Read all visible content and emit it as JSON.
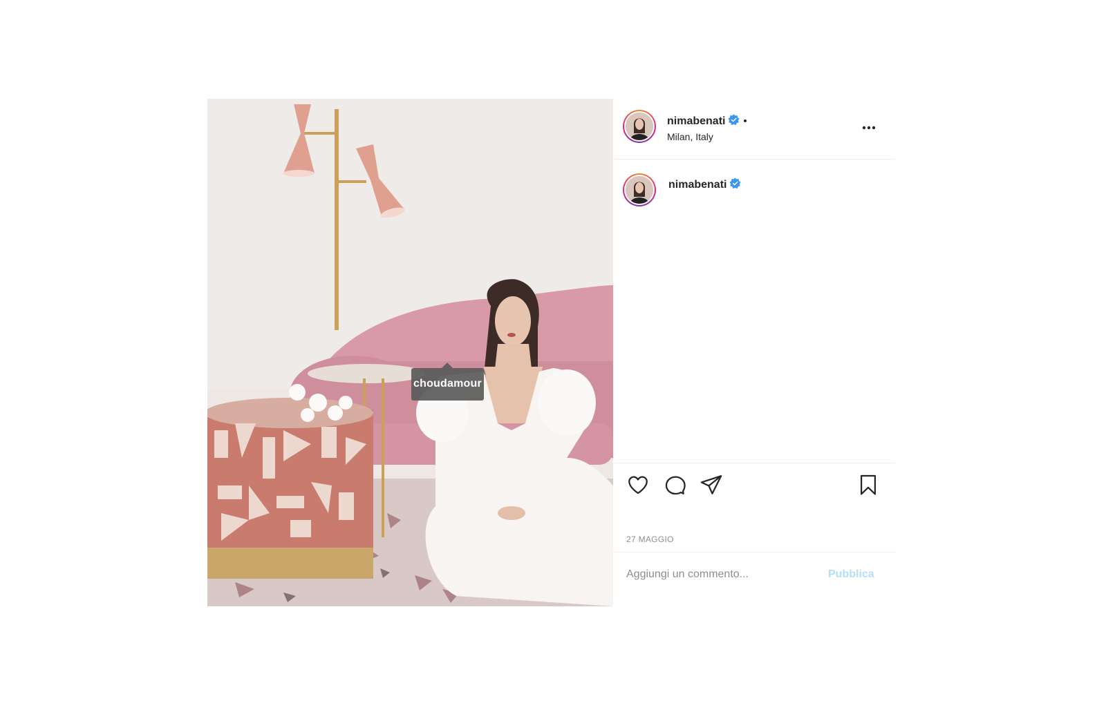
{
  "post": {
    "author": {
      "username": "nimabenati",
      "verified": true,
      "location": "Milan, Italy"
    },
    "photo_tag": "choudamour",
    "caption": {
      "username": "nimabenati",
      "verified": true
    },
    "date": "27 MAGGIO",
    "comment": {
      "placeholder": "Aggiungi un commento...",
      "publish_label": "Pubblica"
    },
    "icons": {
      "more": "more-horizontal-icon",
      "like": "heart-icon",
      "comment": "comment-icon",
      "share": "send-icon",
      "save": "bookmark-icon",
      "verified": "verified-badge-icon"
    },
    "colors": {
      "verified": "#3897f0",
      "publish_disabled": "#b2dffc",
      "story_ring_start": "#f58529",
      "story_ring_end": "#dd2a7b"
    }
  }
}
